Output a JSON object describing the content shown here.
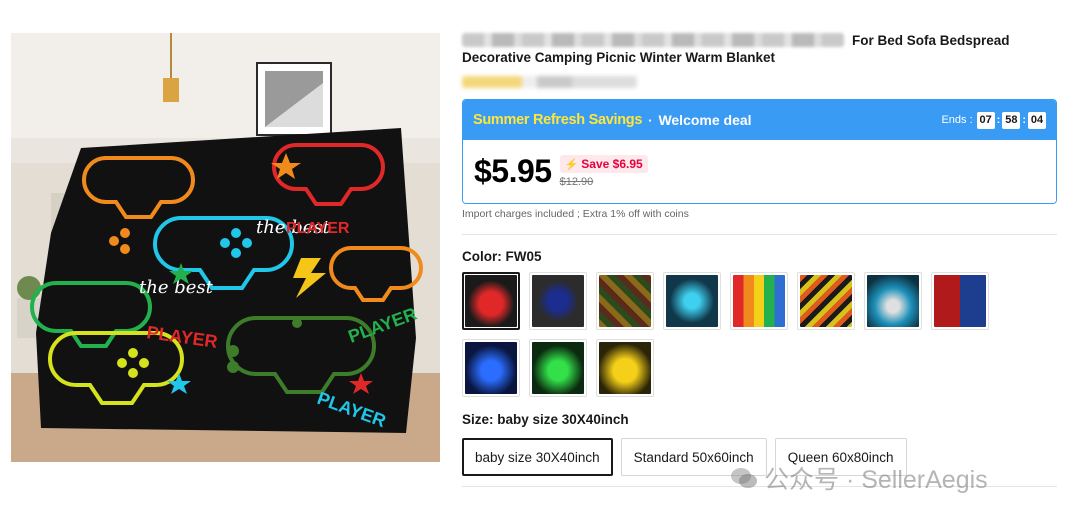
{
  "product": {
    "title_visible": "For Bed Sofa Bedspread Decorative Camping Picnic Winter Warm Blanket",
    "image_alt": "Gamer controller throw blanket"
  },
  "deal": {
    "name": "Summer Refresh Savings",
    "separator": "·",
    "subtitle": "Welcome deal",
    "ends_label": "Ends :",
    "hours": "07",
    "minutes": "58",
    "seconds": "04",
    "price": "$5.95",
    "save": "Save $6.95",
    "original_price": "$12.90",
    "accent": "#3a9bf5",
    "name_color": "#ffe63a"
  },
  "note": "Import charges included ; Extra 1% off with coins",
  "color": {
    "label": "Color: FW05",
    "swatches": [
      {
        "name": "swatch-1",
        "selected": true
      },
      {
        "name": "swatch-2"
      },
      {
        "name": "swatch-3"
      },
      {
        "name": "swatch-4"
      },
      {
        "name": "swatch-5"
      },
      {
        "name": "swatch-6"
      },
      {
        "name": "swatch-7"
      },
      {
        "name": "swatch-8"
      },
      {
        "name": "swatch-9"
      },
      {
        "name": "swatch-10"
      },
      {
        "name": "swatch-11"
      }
    ]
  },
  "size": {
    "label": "Size: baby size 30X40inch",
    "options": [
      "baby size 30X40inch",
      "Standard 50x60inch",
      "Queen 60x80inch"
    ],
    "selected_index": 0
  },
  "watermark": "公众号 · SellerAegis"
}
